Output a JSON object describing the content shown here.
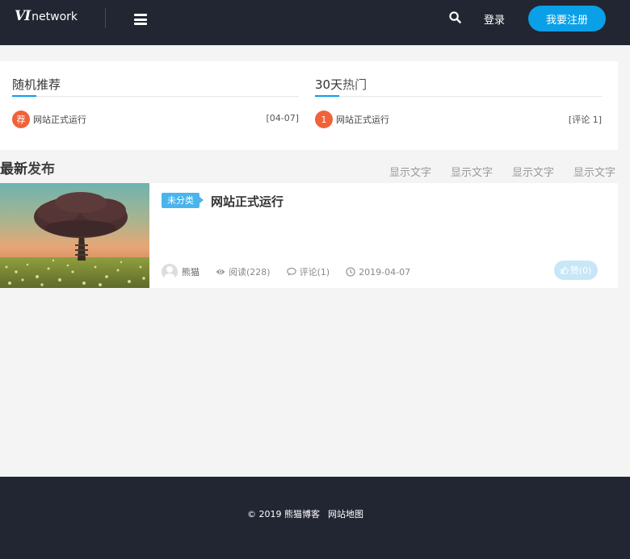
{
  "header": {
    "logo_mark": "VI",
    "logo_text": "network",
    "login_label": "登录",
    "register_label": "我要注册",
    "accent_color": "#0aa0e8",
    "background_color": "#222633"
  },
  "random_widget": {
    "title_highlight": "随机推荐",
    "title_rest": "",
    "items": [
      {
        "badge": "荐",
        "title": "网站正式运行",
        "meta": "[04-07]"
      }
    ]
  },
  "hot_widget": {
    "title_highlight": "30天",
    "title_rest": "热门",
    "items": [
      {
        "badge": "1",
        "title": "网站正式运行",
        "meta": "[评论 1]"
      }
    ]
  },
  "latest": {
    "title_highlight": "最新",
    "title_rest": "发布",
    "tabs": [
      "显示文字",
      "显示文字",
      "显示文字",
      "显示文字"
    ]
  },
  "post": {
    "category": "未分类",
    "title": "网站正式运行",
    "author": "熊猫",
    "views": "阅读(228)",
    "comments": "评论(1)",
    "date": "2019-04-07",
    "likes": "赞(0)"
  },
  "footer": {
    "copyright": "© 2019 熊猫博客",
    "sitemap": "网站地图"
  },
  "icons": {
    "menu": "menu-icon",
    "search": "search-icon",
    "eye": "eye-icon",
    "comment": "comment-icon",
    "clock": "clock-icon",
    "like": "thumbs-up-icon"
  }
}
